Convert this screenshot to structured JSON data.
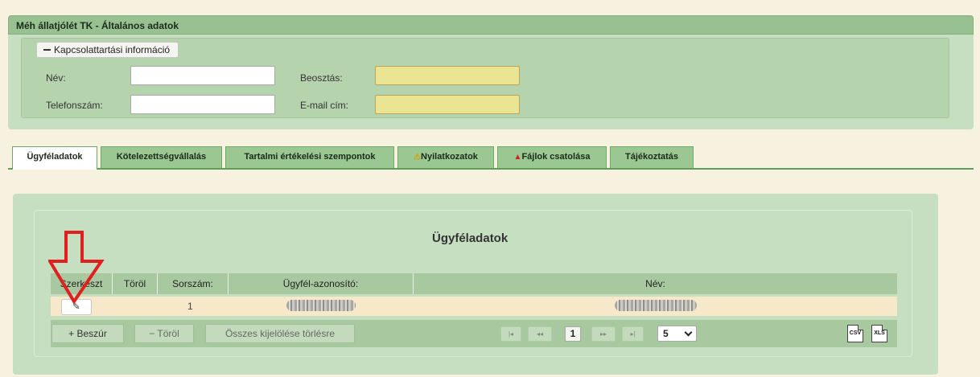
{
  "panel": {
    "title": "Méh állatjólét TK - Általános adatok"
  },
  "contact": {
    "legend": "Kapcsolattartási információ",
    "name_label": "Név:",
    "position_label": "Beosztás:",
    "phone_label": "Telefonszám:",
    "email_label": "E-mail cím:",
    "name_value": "",
    "position_value": "",
    "phone_value": "",
    "email_value": ""
  },
  "tabs": [
    {
      "label": "Ügyféladatok",
      "active": true
    },
    {
      "label": "Kötelezettségvállalás"
    },
    {
      "label": "Tartalmi értékelési szempontok"
    },
    {
      "label": "Nyilatkozatok",
      "icon": "warning-icon"
    },
    {
      "label": "Fájlok csatolása",
      "icon": "alert-icon"
    },
    {
      "label": "Tájékoztatás"
    }
  ],
  "grid": {
    "title": "Ügyféladatok",
    "columns": [
      "Szerkeszt",
      "Töröl",
      "Sorszám:",
      "Ügyfél-azonosító:",
      "Név:"
    ],
    "rows": [
      {
        "sorszam": "1",
        "azonosito": "redacted",
        "nev": "redacted"
      }
    ],
    "footer": {
      "insert_label": "Beszúr",
      "delete_label": "Töröl",
      "clear_all_label": "Összes kijelölése törlésre",
      "page_first": "|◂",
      "page_prev": "◂◂",
      "page_current": "1",
      "page_next": "▸▸",
      "page_last": "▸|",
      "page_size": "5",
      "csv_label": "CSV",
      "xls_label": "XLS"
    }
  },
  "colors": {
    "annotation_arrow": "#e02020",
    "tab_active": "#ffffff",
    "header_green": "#97c190"
  }
}
